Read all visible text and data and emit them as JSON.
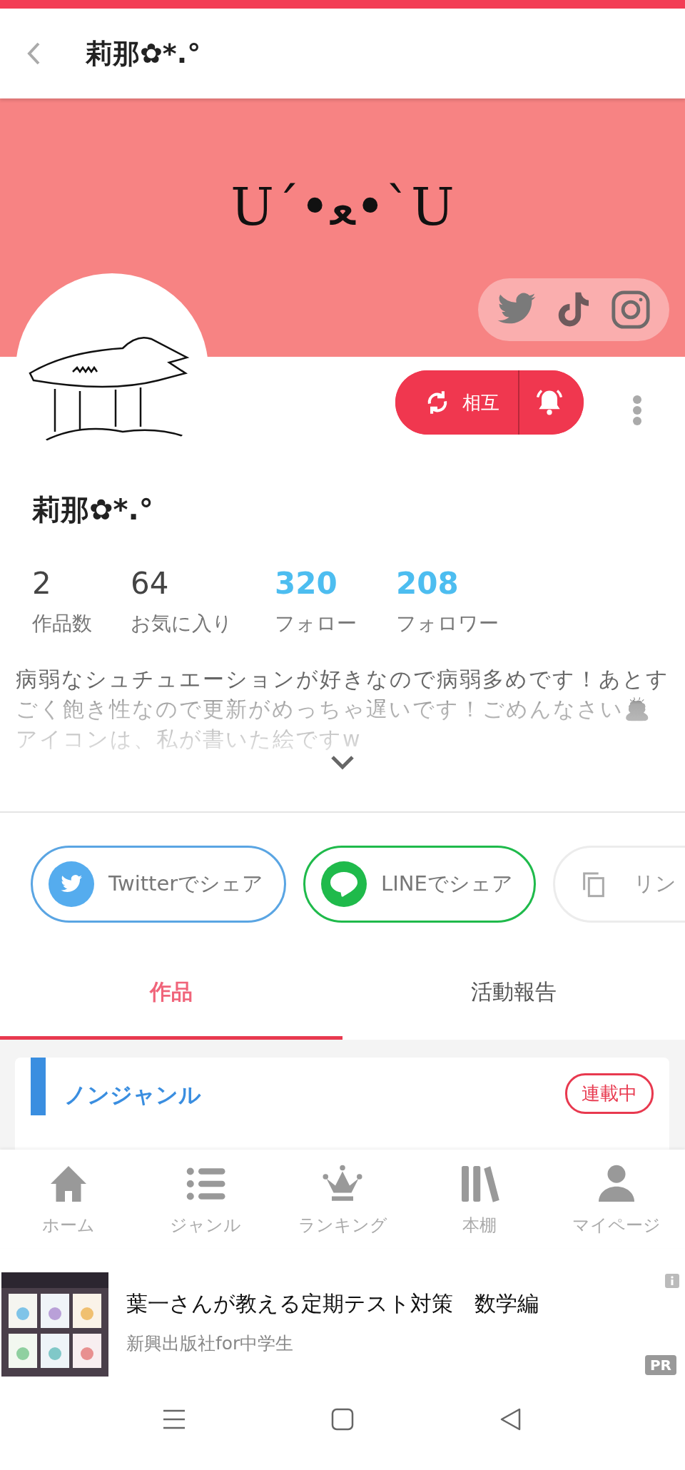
{
  "header": {
    "title": "莉那✿*.°"
  },
  "banner": {
    "text": "U´•ﻌ•`U"
  },
  "follow_button": {
    "label": "相互"
  },
  "profile": {
    "name": "莉那✿*.°",
    "stats": [
      {
        "value": "2",
        "label": "作品数",
        "highlight": false
      },
      {
        "value": "64",
        "label": "お気に入り",
        "highlight": false
      },
      {
        "value": "320",
        "label": "フォロー",
        "highlight": true
      },
      {
        "value": "208",
        "label": "フォロワー",
        "highlight": true
      }
    ],
    "bio": "病弱なシュチュエーションが好きなので病弱多めです！あとすごく飽き性なので更新がめっちゃ遅いです！ごめんなさい🙇\nアイコンは、私が書いた絵ですw"
  },
  "share_buttons": [
    {
      "kind": "twitter",
      "label": "Twitterでシェア"
    },
    {
      "kind": "line",
      "label": "LINEでシェア"
    },
    {
      "kind": "link",
      "label": "リン"
    }
  ],
  "tabs": [
    {
      "label": "作品",
      "selected": true
    },
    {
      "label": "活動報告",
      "selected": false
    }
  ],
  "work_card": {
    "genre": "ノンジャンル",
    "status": "連載中"
  },
  "bottom_nav": [
    {
      "kind": "home",
      "label": "ホーム"
    },
    {
      "kind": "genre",
      "label": "ジャンル"
    },
    {
      "kind": "ranking",
      "label": "ランキング"
    },
    {
      "kind": "shelf",
      "label": "本棚"
    },
    {
      "kind": "mypage",
      "label": "マイページ"
    }
  ],
  "ad": {
    "kind": "picture",
    "title": "葉一さんが教える定期テスト対策　数学編",
    "advertiser": "新興出版社for中学生",
    "badge": "PR"
  }
}
